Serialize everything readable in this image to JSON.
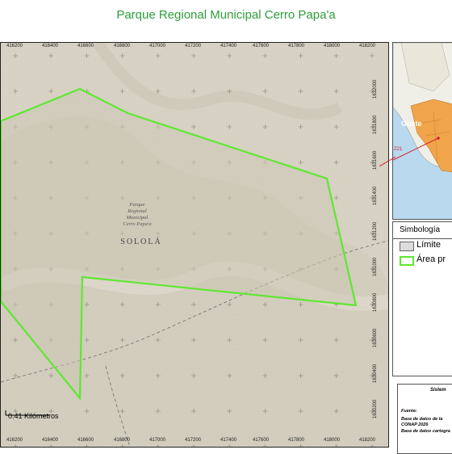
{
  "title": "Parque Regional Municipal Cerro Papa'a",
  "map": {
    "park_label": [
      "Parque",
      "Regional",
      "Municipal",
      "Cerro Papa'a"
    ],
    "department_label": "SOLOLÁ",
    "x_ticks": [
      "416200",
      "416400",
      "416600",
      "416800",
      "417000",
      "417200",
      "417400",
      "417600",
      "417800",
      "418000",
      "418200"
    ],
    "y_ticks": [
      "1632000",
      "1631800",
      "1631600",
      "1631400",
      "1631200",
      "1631000",
      "1630800",
      "1630600",
      "1630400",
      "1630200"
    ],
    "scale_label": "0.41 Kilómetros",
    "colors": {
      "terrain": "#d7d2c4",
      "park_outline": "#5ee830",
      "park_fill": "#ccc6b4",
      "road": "#777777"
    }
  },
  "inset": {
    "country_label": "Guate",
    "pointer_label": "Z21",
    "colors": {
      "water": "#b9d9ee",
      "land": "#f0efe7",
      "guatemala": "#f1a54a",
      "pointer": "#d2232a"
    }
  },
  "legend": {
    "title": "Simbología",
    "items": [
      {
        "label": "Límite",
        "swatch": "#dcdcdc",
        "border": "#666666"
      },
      {
        "label": "Área pr",
        "swatch": "#ffffff",
        "border": "#5ee830"
      }
    ]
  },
  "info": {
    "system": "Sistem",
    "source_title": "Fuente:",
    "source_lines": [
      "Base de datos de la",
      "CONAP 2026",
      "Base de datos cartogra"
    ]
  }
}
